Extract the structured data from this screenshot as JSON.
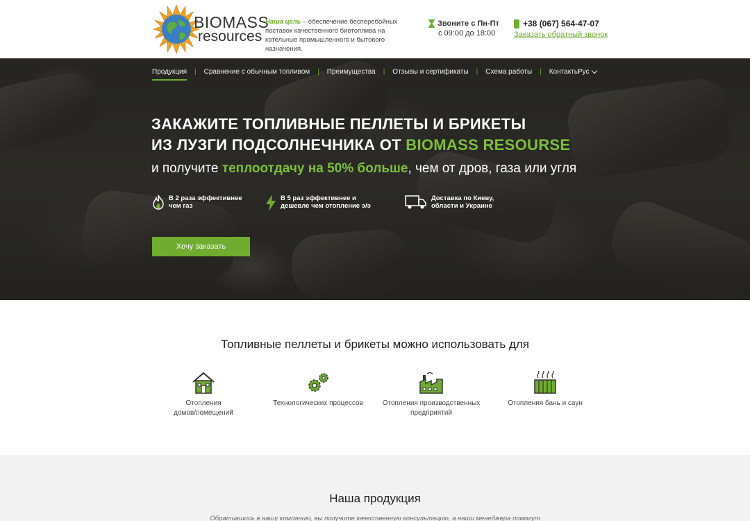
{
  "header": {
    "logo_top": "BIOMASS",
    "logo_bottom": "resources",
    "goal_label": "Наша цель",
    "goal_text": " – обеспечение бесперебойных поставок качественного биотоплива на котельные промышленного и бытового назначения.",
    "hours_title": "Звоните с Пн-Пт",
    "hours_sub": "с 09:00 до 18:00",
    "phone": "+38 (067) 564-47-07",
    "callback": "Заказать обратный звонок"
  },
  "nav": {
    "items": [
      "Продукция",
      "Сравнение с обычным топливом",
      "Преимущества",
      "Отзывы и сертификаты",
      "Схема работы",
      "Контакты"
    ],
    "lang": "Рус"
  },
  "hero": {
    "title_line1": "ЗАКАЖИТЕ ТОПЛИВНЫЕ ПЕЛЛЕТЫ И БРИКЕТЫ",
    "title_line2_prefix": "ИЗ ЛУЗГИ ПОДСОЛНЕЧНИКА ОТ ",
    "title_line2_brand": "BIOMASS RESOURSE",
    "sub_prefix": "и получите ",
    "sub_highlight": "теплоотдачу на 50% больше",
    "sub_suffix": ", чем от дров, газа или угля",
    "features": [
      {
        "icon": "flame-icon",
        "text1": "В 2 раза эффективнее",
        "text2": "чем газ"
      },
      {
        "icon": "lightning-icon",
        "text1": "В 5 раз эффективнее и",
        "text2": "дешевле  чем отопление э/э"
      },
      {
        "icon": "truck-icon",
        "text1": "Доставка по Киеву,",
        "text2": "области и Украине"
      }
    ],
    "cta": "Хочу заказать"
  },
  "uses": {
    "title": "Топливные пеллеты и брикеты можно использовать для",
    "items": [
      {
        "icon": "house-icon",
        "line1": "Отопления",
        "line2": "домов/помещений"
      },
      {
        "icon": "gears-icon",
        "line1": "Технологических процессов",
        "line2": ""
      },
      {
        "icon": "factory-icon",
        "line1": "Отопления производственных",
        "line2": "предприятий"
      },
      {
        "icon": "sauna-icon",
        "line1": "Отопления бань и саун",
        "line2": ""
      }
    ]
  },
  "products": {
    "title": "Наша продукция",
    "desc": "Обратившись в нашу компанию, вы получите качественную консультацию, а наши менеджера помогут"
  },
  "colors": {
    "accent": "#6fac2f",
    "accent_light": "#7cbf3a"
  }
}
